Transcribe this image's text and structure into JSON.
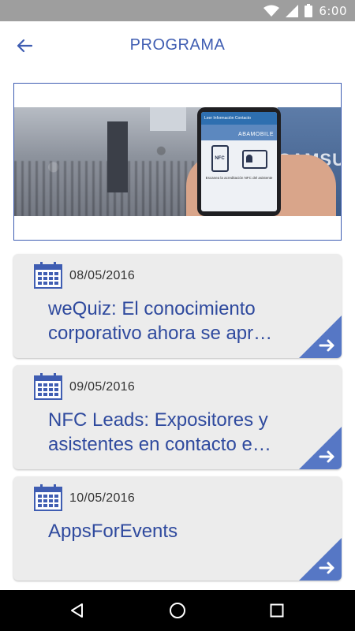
{
  "status_bar": {
    "time": "6:00",
    "icons": [
      "wifi-icon",
      "cell-signal-icon",
      "battery-icon"
    ],
    "background": "#9e9e9e"
  },
  "app_bar": {
    "title": "PROGRAMA",
    "back_icon": "arrow-left-icon",
    "accent": "#3f5db2"
  },
  "banner": {
    "phone_screen": {
      "toolbar_text": "Leer Información Contacto",
      "brand": "ABAMOBILE",
      "nfc_label": "NFC",
      "caption": "Escanea la acreditación NFC del asistente"
    },
    "wall_text": "SAMSU"
  },
  "events": [
    {
      "date": "08/05/2016",
      "title_lines": [
        "weQuiz: El conocimiento",
        "corporativo ahora se apr…"
      ]
    },
    {
      "date": "09/05/2016",
      "title_lines": [
        "NFC Leads: Expositores y",
        "asistentes en contacto e…"
      ]
    },
    {
      "date": "10/05/2016",
      "title_lines": [
        "AppsForEvents",
        ""
      ]
    }
  ],
  "card_icons": {
    "date": "calendar-icon",
    "open": "arrow-right-icon"
  },
  "colors": {
    "card_bg": "#ececec",
    "title": "#2f4a9e",
    "corner": "#5677c5"
  },
  "nav_bar": {
    "buttons": [
      "back-triangle-icon",
      "home-circle-icon",
      "recents-square-icon"
    ]
  }
}
